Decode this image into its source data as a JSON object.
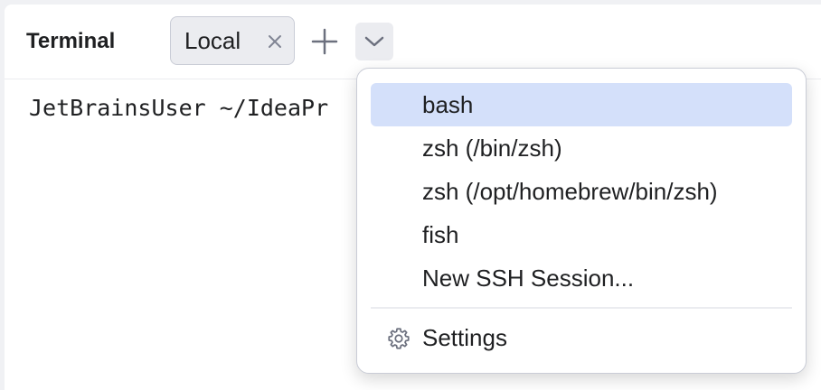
{
  "panel": {
    "title": "Terminal"
  },
  "tabs": [
    {
      "label": "Local",
      "close_icon": "close-icon"
    }
  ],
  "toolbar": {
    "add_icon": "plus-icon",
    "dropdown_icon": "chevron-down-icon"
  },
  "terminal": {
    "prompt_visible": "JetBrainsUser ~/IdeaPr"
  },
  "shell_menu": {
    "items": [
      {
        "label": "bash",
        "selected": true
      },
      {
        "label": "zsh (/bin/zsh)",
        "selected": false
      },
      {
        "label": "zsh (/opt/homebrew/bin/zsh)",
        "selected": false
      },
      {
        "label": "fish",
        "selected": false
      },
      {
        "label": "New SSH Session...",
        "selected": false
      }
    ],
    "settings": {
      "label": "Settings",
      "icon": "gear-icon"
    }
  },
  "colors": {
    "selection": "#d4e0fa",
    "tab_background": "#ebecf0",
    "text": "#1f2022"
  }
}
